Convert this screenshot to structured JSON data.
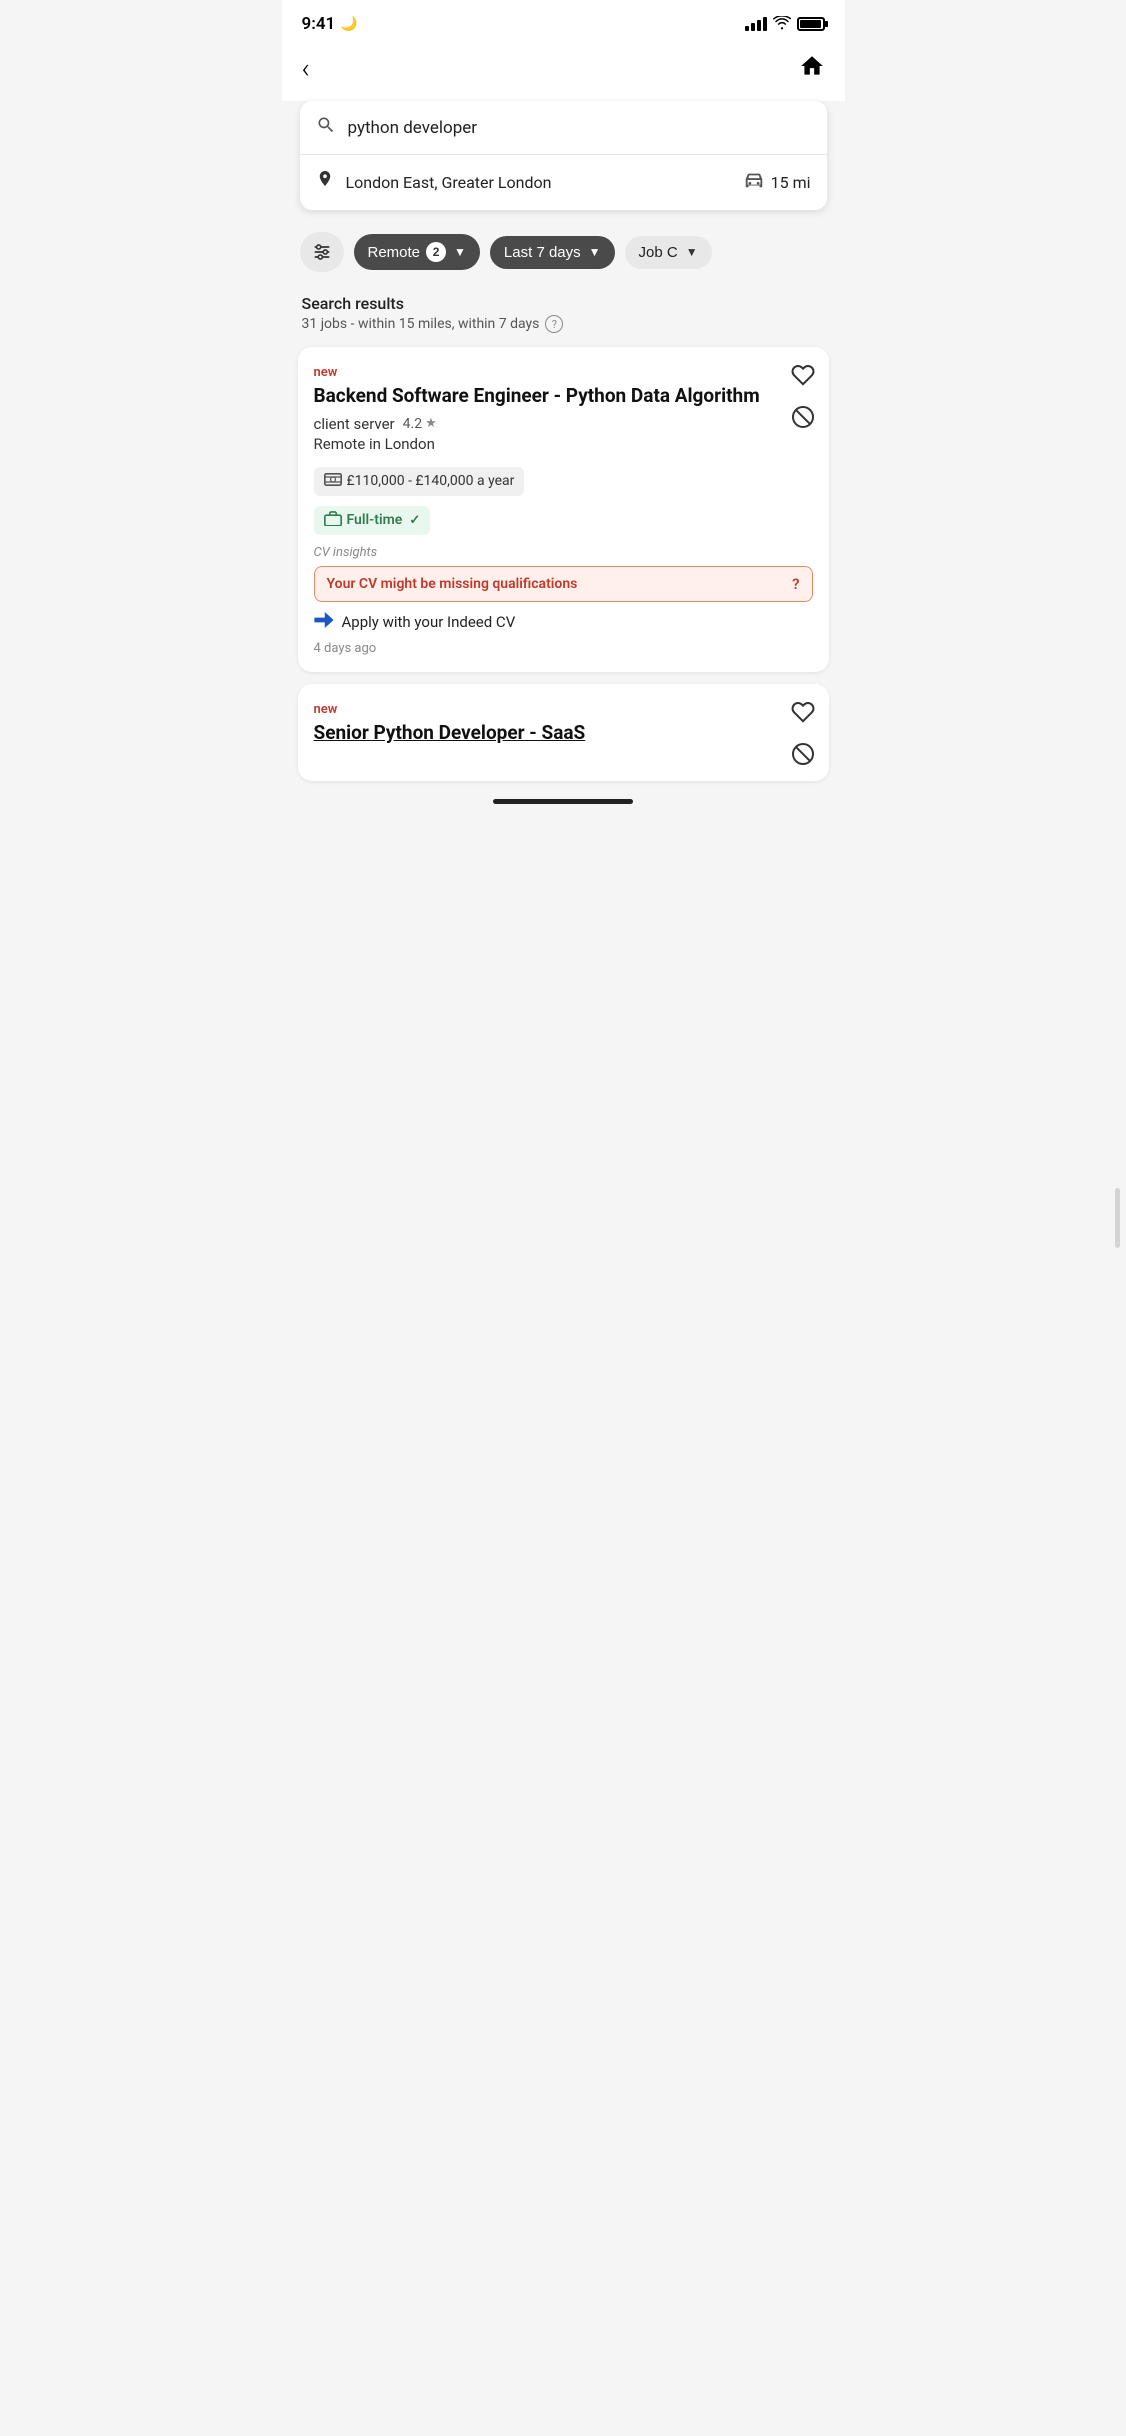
{
  "statusBar": {
    "time": "9:41",
    "moonIcon": "🌙"
  },
  "nav": {
    "backLabel": "‹",
    "homeLabel": "🏠"
  },
  "search": {
    "searchPlaceholder": "python developer",
    "searchValue": "python developer",
    "locationValue": "London East, Greater London",
    "distanceValue": "15 mi"
  },
  "filters": {
    "filterIconLabel": "⚙",
    "remoteLabel": "Remote",
    "remoteBadge": "2",
    "lastDaysLabel": "Last 7 days",
    "jobCLabel": "Job C"
  },
  "results": {
    "title": "Search results",
    "count": "31 jobs - within 15 miles, within 7 days"
  },
  "jobs": [
    {
      "isNew": true,
      "newLabel": "new",
      "title": "Backend Software Engineer - Python Data Algorithm",
      "titleLink": false,
      "company": "client server",
      "rating": "4.2",
      "location": "Remote in London",
      "salary": "£110,000 - £140,000 a year",
      "jobType": "Full-time",
      "cvInsightsLabel": "CV insights",
      "cvWarning": "Your CV might be missing qualifications",
      "applyText": "Apply with your Indeed CV",
      "postedTime": "4 days ago"
    },
    {
      "isNew": true,
      "newLabel": "new",
      "title": "Senior Python Developer - SaaS",
      "titleLink": true,
      "company": "",
      "rating": "",
      "location": "",
      "salary": "",
      "jobType": "",
      "cvInsightsLabel": "",
      "cvWarning": "",
      "applyText": "",
      "postedTime": ""
    }
  ]
}
